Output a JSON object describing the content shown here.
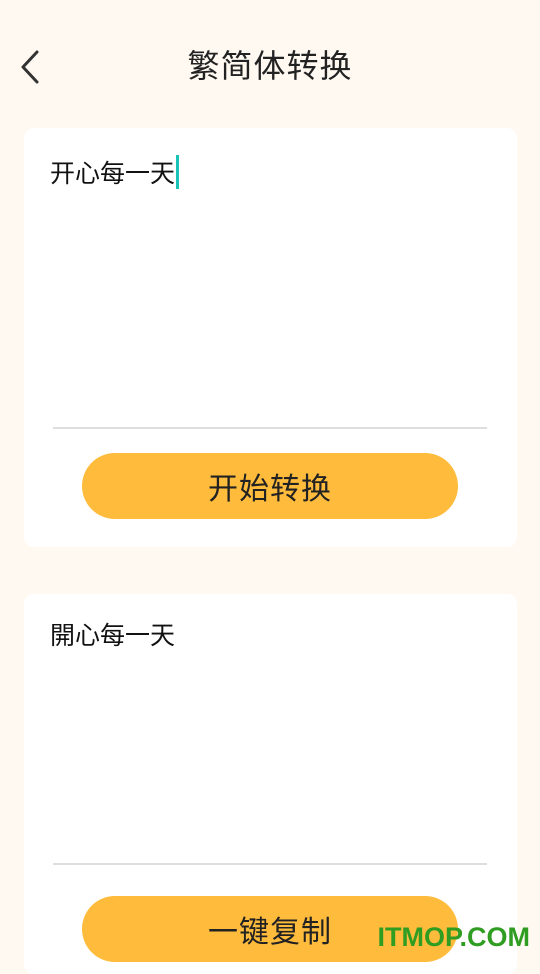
{
  "header": {
    "title": "繁简体转换",
    "back_icon": "chevron-left-icon"
  },
  "input_panel": {
    "text": "开心每一天",
    "button_label": "开始转换"
  },
  "output_panel": {
    "text": "開心每一天",
    "button_label": "一键复制"
  },
  "watermark": {
    "text": "ITMOP.COM"
  },
  "colors": {
    "background": "#fff9f2",
    "card": "#ffffff",
    "button": "#ffbc3c",
    "caret": "#19c3b8",
    "watermark": "#2f9c22"
  }
}
